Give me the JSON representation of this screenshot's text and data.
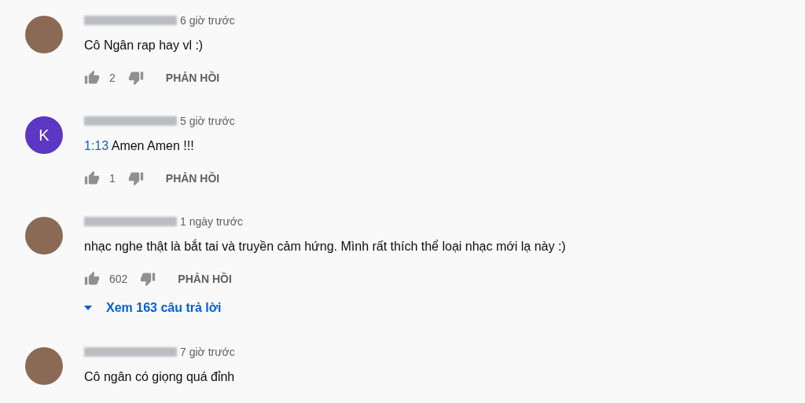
{
  "comments": [
    {
      "avatar": {
        "kind": "photo"
      },
      "time": "6 giờ trước",
      "text": "Cô Ngân rap hay vl :)",
      "likes": "2",
      "reply_label": "PHẢN HỒI"
    },
    {
      "avatar": {
        "kind": "letter",
        "letter": "K",
        "color": "#5b37c4"
      },
      "time": "5 giờ trước",
      "timestamp": "1:13",
      "text": "Amen Amen !!!",
      "likes": "1",
      "reply_label": "PHẢN HỒI"
    },
    {
      "avatar": {
        "kind": "photo"
      },
      "time": "1 ngày trước",
      "text": "nhạc nghe thật là bắt tai và truyền cảm hứng. Mình rất thích thể loại nhạc mới lạ này :)",
      "likes": "602",
      "reply_label": "PHẢN HỒI",
      "replies_link": "Xem 163 câu trả lời"
    },
    {
      "avatar": {
        "kind": "photo"
      },
      "time": "7 giờ trước",
      "text": "Cô ngân có giọng quá đỉnh"
    }
  ]
}
